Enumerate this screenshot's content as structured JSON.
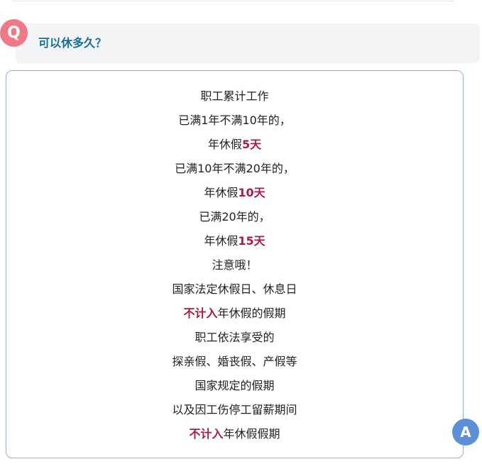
{
  "question": {
    "badge": "Q",
    "text": "可以休多久？"
  },
  "answer": {
    "badge": "A",
    "lines": [
      {
        "pre": "职工累计工作",
        "hl": "",
        "post": ""
      },
      {
        "pre": "已满1年不满10年的，",
        "hl": "",
        "post": ""
      },
      {
        "pre": "年休假",
        "hl": "5天",
        "post": ""
      },
      {
        "pre": "已满10年不满20年的，",
        "hl": "",
        "post": ""
      },
      {
        "pre": "年休假",
        "hl": "10天",
        "post": ""
      },
      {
        "pre": "已满20年的，",
        "hl": "",
        "post": ""
      },
      {
        "pre": "年休假",
        "hl": "15天",
        "post": ""
      },
      {
        "pre": "注意哦！",
        "hl": "",
        "post": ""
      },
      {
        "pre": "国家法定休假日、休息日",
        "hl": "",
        "post": ""
      },
      {
        "pre": "",
        "hl": "不计入",
        "post": "年休假的假期"
      },
      {
        "pre": "职工依法享受的",
        "hl": "",
        "post": ""
      },
      {
        "pre": "探亲假、婚丧假、产假等",
        "hl": "",
        "post": ""
      },
      {
        "pre": "国家规定的假期",
        "hl": "",
        "post": ""
      },
      {
        "pre": "以及因工伤停工留薪期间",
        "hl": "",
        "post": ""
      },
      {
        "pre": "",
        "hl": "不计入",
        "post": "年休假假期"
      }
    ]
  },
  "colors": {
    "q_badge": "#ef7a87",
    "q_text": "#176f98",
    "highlight": "#a51d42",
    "a_badge": "#5d8fd6",
    "card_border": "#92b2dd"
  }
}
